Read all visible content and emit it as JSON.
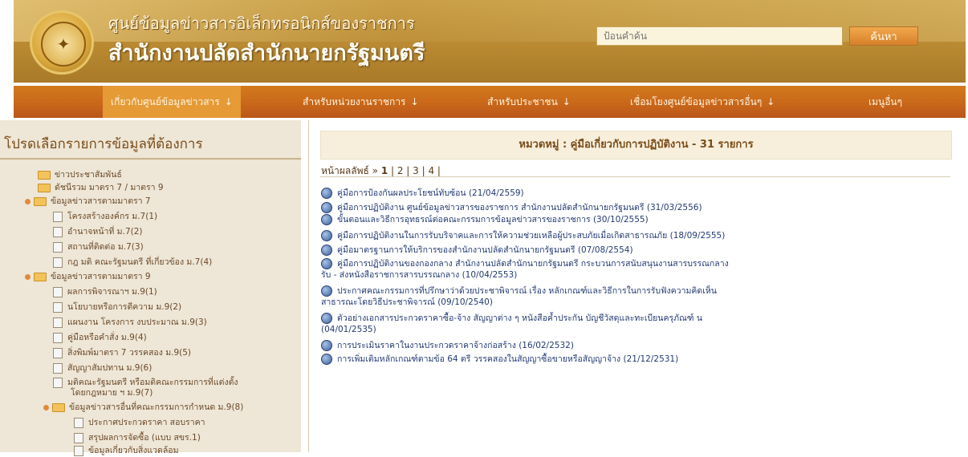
{
  "header": {
    "title_line1": "ศูนย์ข้อมูลข่าวสารอิเล็กทรอนิกส์ของราชการ",
    "title_line2": "สำนักงานปลัดสำนักนายกรัฐมนตรี",
    "search_placeholder": "ป้อนคำค้น",
    "search_button": "ค้นหา",
    "logo_icon": "garuda-emblem-icon"
  },
  "nav": {
    "items": [
      {
        "label": "เกี่ยวกับศูนย์ข้อมูลข่าวสาร",
        "arrow": "↓"
      },
      {
        "label": "สำหรับหน่วยงานราชการ",
        "arrow": "↓"
      },
      {
        "label": "สำหรับประชาชน",
        "arrow": "↓"
      },
      {
        "label": "เชื่อมโยงศูนย์ข้อมูลข่าวสารอื่นๆ",
        "arrow": "↓"
      },
      {
        "label": "เมนูอื่นๆ",
        "arrow": ""
      }
    ]
  },
  "sidebar": {
    "title": "โปรดเลือกรายการข้อมูลที่ต้องการ",
    "items": [
      {
        "label": "ข่าวประชาสัมพันธ์"
      },
      {
        "label": "ดัชนีรวม มาตรา 7 / มาตรา 9"
      },
      {
        "label": "ข้อมูลข่าวสารตามมาตรา 7"
      },
      {
        "label": "โครงสร้างองค์กร ม.7(1)"
      },
      {
        "label": "อำนาจหน้าที่ ม.7(2)"
      },
      {
        "label": "สถานที่ติดต่อ ม.7(3)"
      },
      {
        "label": "กฎ มติ คณะรัฐมนตรี ที่เกี่ยวข้อง ม.7(4)"
      },
      {
        "label": "ข้อมูลข่าวสารตามมาตรา 9"
      },
      {
        "label": "ผลการพิจารณาฯ ม.9(1)"
      },
      {
        "label": "นโยบายหรือการตีความ ม.9(2)"
      },
      {
        "label": "แผนงาน โครงการ งบประมาณ ม.9(3)"
      },
      {
        "label": "คู่มือหรือคำสั่ง ม.9(4)"
      },
      {
        "label": "สิ่งพิมพ์มาตรา 7 วรรคสอง ม.9(5)"
      },
      {
        "label": "สัญญาสัมปทาน ม.9(6)"
      },
      {
        "label": "มติคณะรัฐมนตรี หรือมติคณะกรรมการที่แต่งตั้ง"
      },
      {
        "label": "โดยกฎหมาย ฯ ม.9(7)"
      },
      {
        "label": "ข้อมูลข่าวสารอื่นที่คณะกรรมการกำหนด ม.9(8)"
      },
      {
        "label": "ประกาศประกวดราคา สอบราคา"
      },
      {
        "label": "สรุปผลการจัดซื้อ (แบบ สขร.1)"
      },
      {
        "label": "ข้อมูลเกี่ยวกับสิ่งแวดล้อม"
      }
    ]
  },
  "main": {
    "category_title": "หมวดหมู่ : คู่มือเกี่ยวกับการปฏิบัติงาน - 31 รายการ",
    "pagination": {
      "label": "หน้าผลลัพธ์ »",
      "pages": [
        "1",
        "2",
        "3",
        "4"
      ],
      "current": "1"
    },
    "results": [
      {
        "lines": [
          "คู่มือการป้องกันผลประโยชน์ทับซ้อน (21/04/2559)"
        ]
      },
      {
        "lines": [
          "คู่มือการปฏิบัติงาน ศูนย์ข้อมูลข่าวสารของราชการ สำนักงานปลัดสำนักนายกรัฐมนตรี (31/03/2556)"
        ]
      },
      {
        "lines": [
          "ขั้นตอนและวิธีการอุทธรณ์ต่อคณะกรรมการข้อมูลข่าวสารของราชการ (30/10/2555)"
        ]
      },
      {
        "lines": [
          "คู่มือการปฏิบัติงานในการรับบริจาคและการให้ความช่วยเหลือผู้ประสบภัยเมื่อเกิดสาธารณภัย (18/09/2555)"
        ]
      },
      {
        "lines": [
          "คู่มือมาตรฐานการให้บริการของสำนักงานปลัดสำนักนายกรัฐมนตรี (07/08/2554)"
        ]
      },
      {
        "lines": [
          "คู่มือการปฏิบัติงานของกองกลาง สำนักงานปลัดสำนักนายกรัฐมนตรี กระบวนการสนับสนุนงานสารบรรณกลาง",
          "รับ - ส่งหนังสือราชการสารบรรณกลาง (10/04/2553)"
        ]
      },
      {
        "lines": [
          "ประกาศคณะกรรมการที่ปรึกษาว่าด้วยประชาพิจารณ์ เรื่อง หลักเกณฑ์และวิธีการในการรับฟังความคิดเห็น",
          "สาธารณะโดยวิธีประชาพิจารณ์ (09/10/2540)"
        ]
      },
      {
        "lines": [
          "ตัวอย่างเอกสารประกวดราคาซื้อ-จ้าง สัญญาต่าง ๆ หนังสือค้ำประกัน บัญชีวัสดุและทะเบียนครุภัณฑ์ น",
          "(04/01/2535)"
        ]
      },
      {
        "lines": [
          "การประเมินราคาในงานประกวดราคาจ้างก่อสร้าง (16/02/2532)"
        ]
      },
      {
        "lines": [
          "การเพิ่มเติมหลักเกณฑ์ตามข้อ 64 ตรี วรรคสองในสัญญาซื้อขายหรือสัญญาจ้าง (21/12/2531)"
        ]
      }
    ],
    "result_icon": "document-search-icon"
  },
  "colors": {
    "header_gold": "#b98a32",
    "nav_orange": "#c8661a",
    "sidebar_bg": "#eee6d6",
    "link_blue": "#233a72"
  }
}
